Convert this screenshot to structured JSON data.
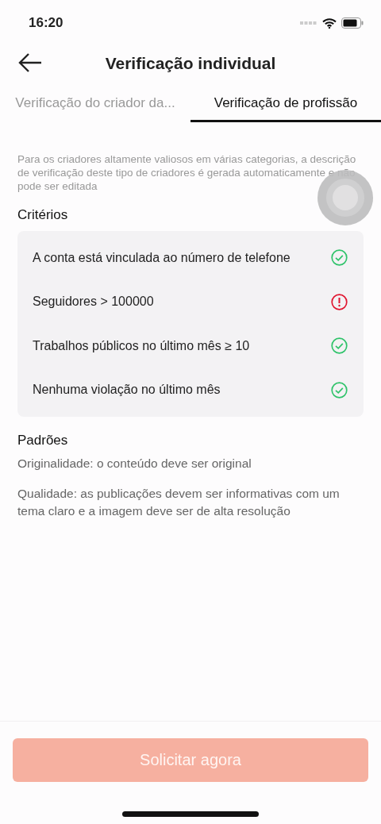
{
  "status_bar": {
    "time": "16:20"
  },
  "header": {
    "title": "Verificação individual"
  },
  "tabs": [
    {
      "label": "Verificação do criador da...",
      "selected": false
    },
    {
      "label": "Verificação de profissão",
      "selected": true
    }
  ],
  "description": "Para os criadores altamente valiosos em várias categorias, a descrição de verificação deste tipo de criadores é gerada automaticamente e não pode ser editada",
  "criteria": {
    "title": "Critérios",
    "items": [
      {
        "label": "A conta está vinculada ao número de telefone",
        "passed": true
      },
      {
        "label": "Seguidores > 100000",
        "passed": false
      },
      {
        "label": "Trabalhos públicos no último mês ≥ 10",
        "passed": true
      },
      {
        "label": "Nenhuma violação no último mês",
        "passed": true
      }
    ]
  },
  "standards": {
    "title": "Padrões",
    "items": [
      "Originalidade: o conteúdo deve ser original",
      "Qualidade: as publicações devem ser informativas com um tema claro e a imagem deve ser de alta resolução"
    ]
  },
  "apply_button": {
    "label": "Solicitar agora",
    "disabled": true
  }
}
